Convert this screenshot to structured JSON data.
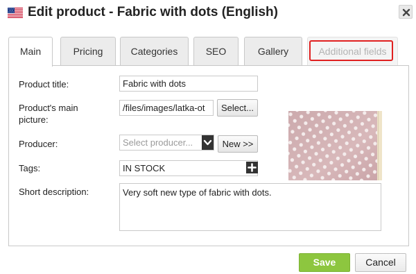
{
  "dialog": {
    "title": "Edit product - Fabric with dots (English)",
    "flag_icon": "us-flag-icon",
    "close_icon": "close-icon"
  },
  "tabs": [
    {
      "label": "Main",
      "state": "active"
    },
    {
      "label": "Pricing",
      "state": "normal"
    },
    {
      "label": "Categories",
      "state": "normal"
    },
    {
      "label": "SEO",
      "state": "normal"
    },
    {
      "label": "Gallery",
      "state": "normal"
    },
    {
      "label": "Additional fields",
      "state": "disabled",
      "highlighted": true
    }
  ],
  "form": {
    "product_title": {
      "label": "Product title:",
      "value": "Fabric with dots"
    },
    "main_picture": {
      "label_line1": "Product's main",
      "label_line2": "picture:",
      "value": "/files/images/latka-ot",
      "button": "Select..."
    },
    "producer": {
      "label": "Producer:",
      "placeholder": "Select producer...",
      "button": "New >>"
    },
    "tags": {
      "label": "Tags:",
      "value": "IN STOCK"
    },
    "short_description": {
      "label": "Short description:",
      "value": "Very soft new type of fabric with dots."
    }
  },
  "footer": {
    "save_label": "Save",
    "cancel_label": "Cancel"
  },
  "colors": {
    "save_green": "#8dc63f",
    "highlight_red": "#e02020",
    "fabric_pink": "#d9b6b8"
  }
}
